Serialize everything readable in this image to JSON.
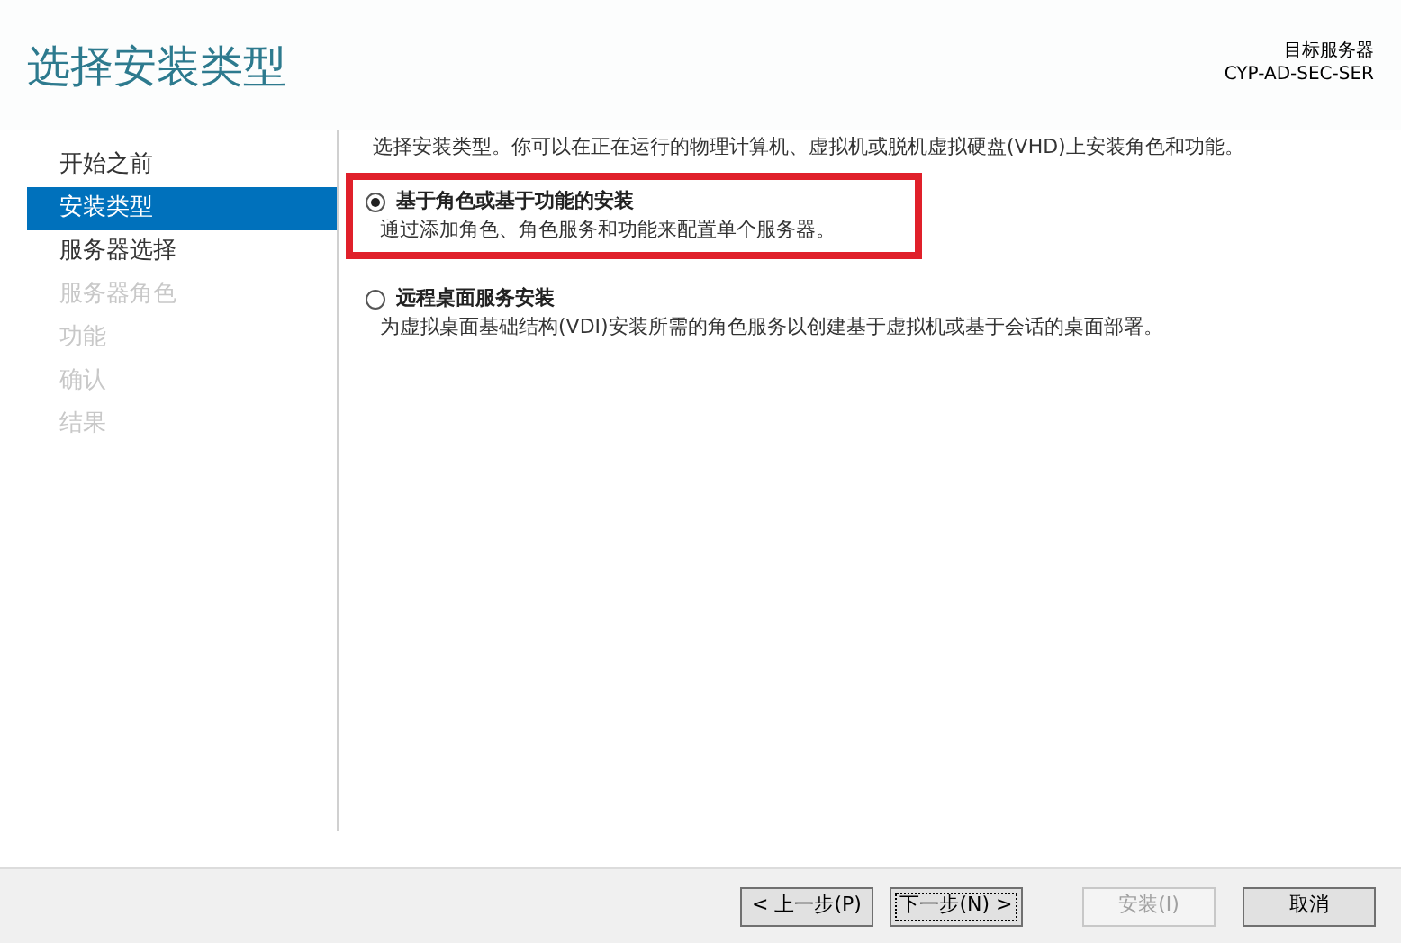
{
  "header": {
    "title": "选择安装类型",
    "target_label": "目标服务器",
    "target_name": "CYP-AD-SEC-SER"
  },
  "sidebar": {
    "items": [
      {
        "label": "开始之前",
        "selected": false,
        "disabled": false
      },
      {
        "label": "安装类型",
        "selected": true,
        "disabled": false
      },
      {
        "label": "服务器选择",
        "selected": false,
        "disabled": false
      },
      {
        "label": "服务器角色",
        "selected": false,
        "disabled": true
      },
      {
        "label": "功能",
        "selected": false,
        "disabled": true
      },
      {
        "label": "确认",
        "selected": false,
        "disabled": true
      },
      {
        "label": "结果",
        "selected": false,
        "disabled": true
      }
    ]
  },
  "content": {
    "intro": "选择安装类型。你可以在正在运行的物理计算机、虚拟机或脱机虚拟硬盘(VHD)上安装角色和功能。",
    "options": [
      {
        "label": "基于角色或基于功能的安装",
        "description": "通过添加角色、角色服务和功能来配置单个服务器。",
        "selected": true,
        "highlighted": true
      },
      {
        "label": "远程桌面服务安装",
        "description": "为虚拟桌面基础结构(VDI)安装所需的角色服务以创建基于虚拟机或基于会话的桌面部署。",
        "selected": false,
        "highlighted": false
      }
    ]
  },
  "buttons": [
    {
      "label": "< 上一步(P)",
      "disabled": false,
      "focused": false
    },
    {
      "label": "下一步(N) >",
      "disabled": false,
      "focused": true
    },
    {
      "label": "安装(I)",
      "disabled": true,
      "focused": false
    },
    {
      "label": "取消",
      "disabled": false,
      "focused": false
    }
  ]
}
